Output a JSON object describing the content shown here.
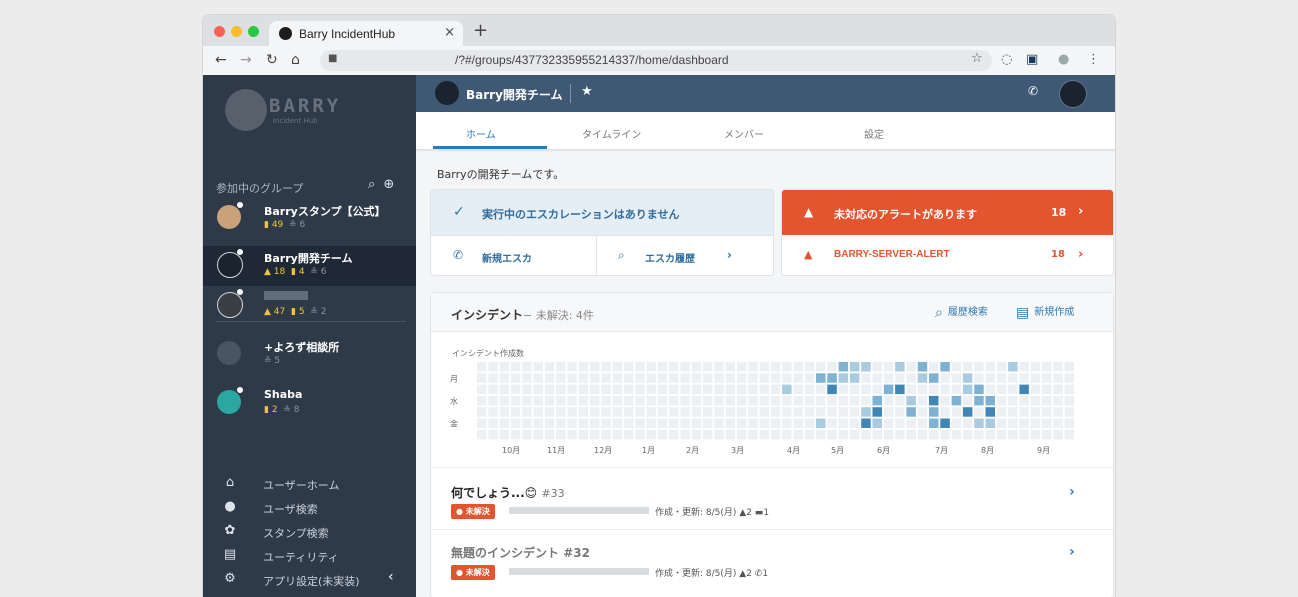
{
  "browser": {
    "tab_title": "Barry IncidentHub",
    "tab_close": "×",
    "new_tab": "+",
    "url": "/?#/groups/437732335955214337/home/dashboard",
    "star": "☆"
  },
  "sidebar": {
    "logo_text": "BARRY",
    "logo_sub": "Incident Hub",
    "groups_heading": "参加中のグループ",
    "groups": [
      {
        "name": "Barryスタンプ【公式】",
        "stamps": "49",
        "members": "6",
        "color": "#c9a27a"
      },
      {
        "name": "Barry開発チーム",
        "alerts": "18",
        "stamps": "4",
        "members": "6",
        "color": "#1b242e"
      },
      {
        "name": "",
        "alerts": "47",
        "stamps": "5",
        "members": "2",
        "color": "#3a3f44"
      },
      {
        "name": "+よろず相談所",
        "members": "5",
        "color": "#4a5562"
      },
      {
        "name": "Shaba",
        "stamps": "2",
        "members": "8",
        "color": "#29a7a0"
      }
    ],
    "menu": [
      {
        "icon": "home-icon",
        "label": "ユーザーホーム"
      },
      {
        "icon": "user-search-icon",
        "label": "ユーザ検索"
      },
      {
        "icon": "paw-icon",
        "label": "スタンプ検索"
      },
      {
        "icon": "list-icon",
        "label": "ユーティリティ"
      },
      {
        "icon": "gear-icon",
        "label": "アプリ設定(未実装)"
      }
    ]
  },
  "header": {
    "team_name": "Barry開発チーム"
  },
  "tabs": [
    "ホーム",
    "タイムライン",
    "メンバー",
    "設定"
  ],
  "description": "Barryの開発チームです。",
  "escalation": {
    "status": "実行中のエスカレーションはありません",
    "new_label": "新規エスカ",
    "history_label": "エスカ履歴"
  },
  "alert": {
    "title": "未対応のアラートがあります",
    "count": "18",
    "source": "BARRY-SERVER-ALERT",
    "source_count": "18"
  },
  "incidents": {
    "title": "インシデント",
    "subtitle": "− 未解決: 4件",
    "search_label": "履歴検索",
    "new_label": "新規作成",
    "heatmap_label": "インシデント作成数",
    "day_labels": [
      "月",
      "水",
      "金"
    ],
    "month_labels": [
      "10月",
      "11月",
      "12月",
      "1月",
      "2月",
      "3月",
      "4月",
      "5月",
      "6月",
      "7月",
      "8月",
      "9月"
    ],
    "items": [
      {
        "title": "何でしょう...😊",
        "number": "#33",
        "status": "未解決",
        "meta": "作成・更新: 8/5(月)",
        "alerts": "2",
        "comments": "1"
      },
      {
        "title": "無題のインシデント",
        "number": "#32",
        "status": "未解決",
        "meta": "作成・更新: 8/5(月)",
        "alerts": "2",
        "calls": "1"
      }
    ]
  },
  "colors": {
    "sidebar": "#2e3a48",
    "header": "#3f5873",
    "accent": "#2f7ab4",
    "alert": "#e2552f"
  }
}
